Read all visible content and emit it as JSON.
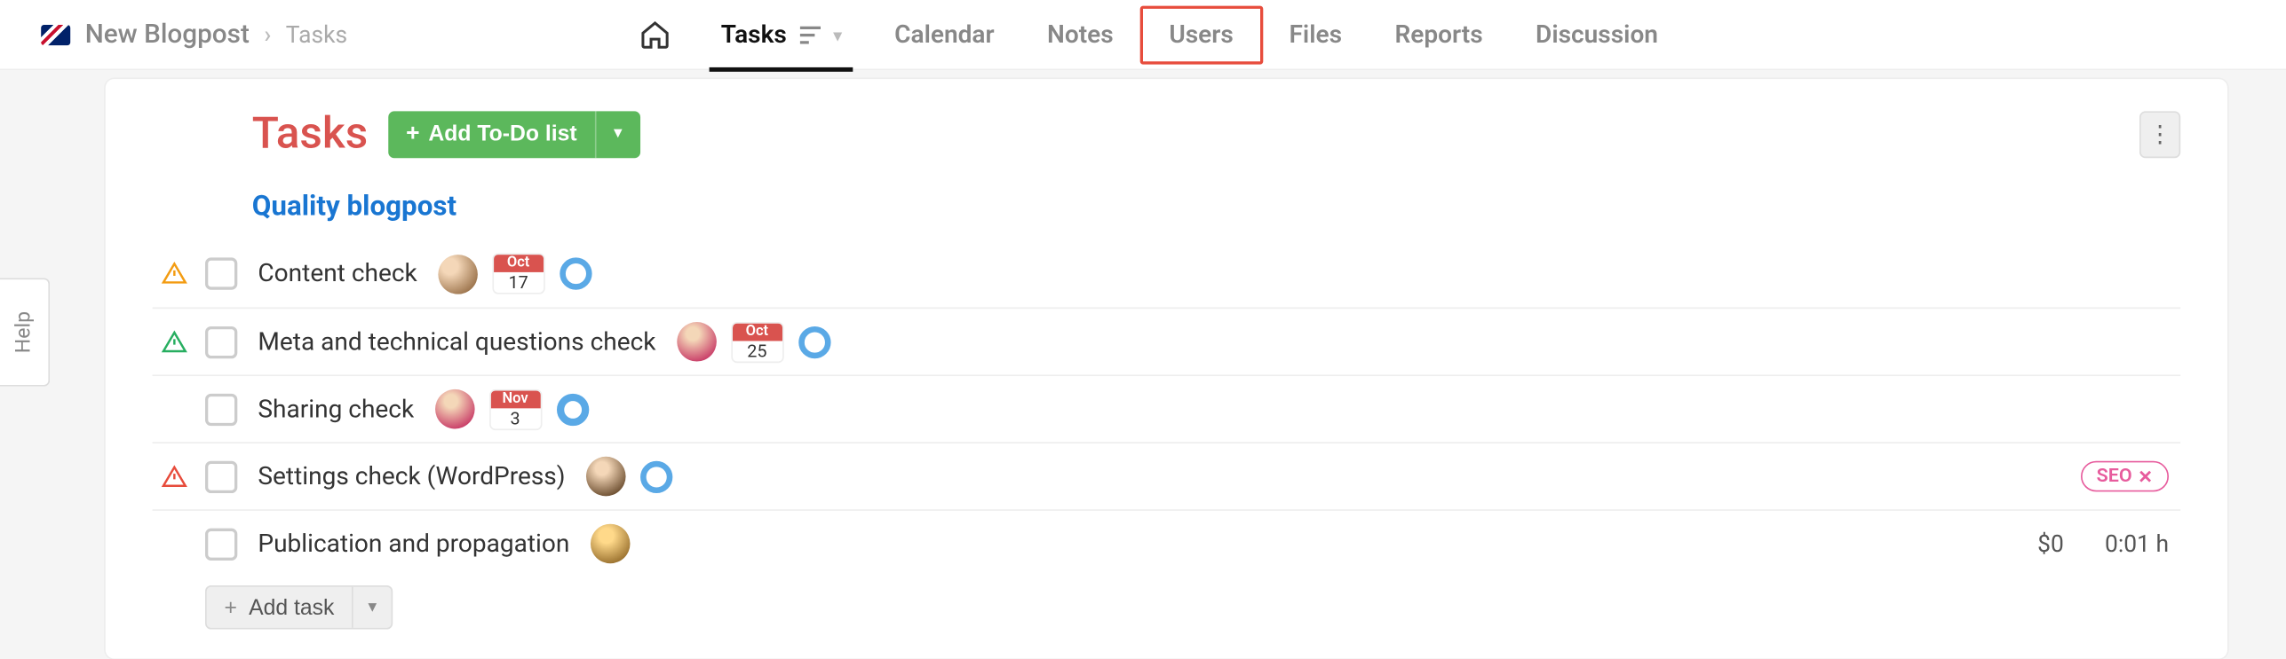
{
  "help_label": "Help",
  "breadcrumb": {
    "project": "New Blogpost",
    "current": "Tasks"
  },
  "nav": {
    "active": "Tasks",
    "highlighted": "Users",
    "items": [
      "Tasks",
      "Calendar",
      "Notes",
      "Users",
      "Files",
      "Reports",
      "Discussion"
    ]
  },
  "page": {
    "title": "Tasks",
    "add_todo_label": "Add To-Do list",
    "add_task_label": "Add task"
  },
  "list": {
    "name": "Quality blogpost",
    "tasks": [
      {
        "name": "Content check",
        "warn": "orange",
        "avatar": "a",
        "date": {
          "m": "Oct",
          "d": "17"
        },
        "ring": true,
        "tag": null,
        "price": null,
        "time": null
      },
      {
        "name": "Meta and technical questions check",
        "warn": "green",
        "avatar": "b",
        "date": {
          "m": "Oct",
          "d": "25"
        },
        "ring": true,
        "tag": null,
        "price": null,
        "time": null
      },
      {
        "name": "Sharing check",
        "warn": null,
        "avatar": "c",
        "date": {
          "m": "Nov",
          "d": "3"
        },
        "ring": true,
        "tag": null,
        "price": null,
        "time": null
      },
      {
        "name": "Settings check (WordPress)",
        "warn": "red",
        "avatar": "d",
        "date": null,
        "ring": true,
        "tag": "SEO",
        "price": null,
        "time": null
      },
      {
        "name": "Publication and propagation",
        "warn": null,
        "avatar": "e",
        "date": null,
        "ring": false,
        "tag": null,
        "price": "$0",
        "time": "0:01 h"
      }
    ]
  }
}
